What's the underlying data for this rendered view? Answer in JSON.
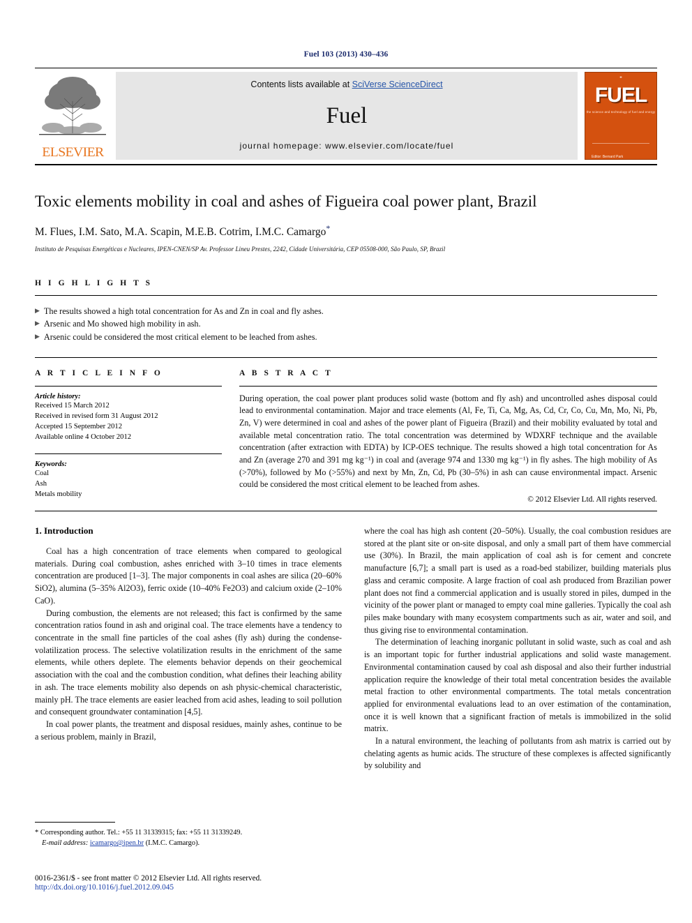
{
  "running_head": "Fuel 103 (2013) 430–436",
  "banner": {
    "publisher_name": "ELSEVIER",
    "contents_prefix": "Contents lists available at ",
    "contents_link": "SciVerse ScienceDirect",
    "journal_name": "Fuel",
    "homepage": "journal homepage: www.elsevier.com/locate/fuel",
    "cover_title": "FUEL",
    "cover_subtitle": "the science and technology of fuel and energy",
    "cover_footer": "Editor: Bernard Park",
    "cover_color": "#d4510f",
    "link_color": "#2554a8"
  },
  "article": {
    "title": "Toxic elements mobility in coal and ashes of Figueira coal power plant, Brazil",
    "authors": "M. Flues, I.M. Sato, M.A. Scapin, M.E.B. Cotrim, I.M.C. Camargo",
    "corresponding_marker": "*",
    "affiliation": "Instituto de Pesquisas Energéticas e Nucleares, IPEN-CNEN/SP Av. Professor Lineu Prestes, 2242, Cidade Universitária, CEP 05508-000, São Paulo, SP, Brazil"
  },
  "highlights": {
    "heading": "H I G H L I G H T S",
    "bullet_glyph": "▶",
    "items": [
      "The results showed a high total concentration for As and Zn in coal and fly ashes.",
      "Arsenic and Mo showed high mobility in ash.",
      "Arsenic could be considered the most critical element to be leached from ashes."
    ]
  },
  "article_info": {
    "heading": "A R T I C L E   I N F O",
    "history_heading": "Article history:",
    "history": [
      "Received 15 March 2012",
      "Received in revised form 31 August 2012",
      "Accepted 15 September 2012",
      "Available online 4 October 2012"
    ],
    "keywords_heading": "Keywords:",
    "keywords": [
      "Coal",
      "Ash",
      "Metals mobility"
    ]
  },
  "abstract": {
    "heading": "A B S T R A C T",
    "text": "During operation, the coal power plant produces solid waste (bottom and fly ash) and uncontrolled ashes disposal could lead to environmental contamination. Major and trace elements (Al, Fe, Ti, Ca, Mg, As, Cd, Cr, Co, Cu, Mn, Mo, Ni, Pb, Zn, V) were determined in coal and ashes of the power plant of Figueira (Brazil) and their mobility evaluated by total and available metal concentration ratio. The total concentration was determined by WDXRF technique and the available concentration (after extraction with EDTA) by ICP-OES technique. The results showed a high total concentration for As and Zn (average 270 and 391 mg kg⁻¹) in coal and (average 974 and 1330 mg kg⁻¹) in fly ashes. The high mobility of As (>70%), followed by Mo (>55%) and next by Mn, Zn, Cd, Pb (30–5%) in ash can cause environmental impact. Arsenic could be considered the most critical element to be leached from ashes.",
    "copyright": "© 2012 Elsevier Ltd. All rights reserved."
  },
  "introduction": {
    "heading": "1. Introduction",
    "left_paragraphs": [
      "Coal has a high concentration of trace elements when compared to geological materials. During coal combustion, ashes enriched with 3–10 times in trace elements concentration are produced [1–3]. The major components in coal ashes are silica (20–60% SiO2), alumina (5–35% Al2O3), ferric oxide (10–40% Fe2O3) and calcium oxide (2–10% CaO).",
      "During combustion, the elements are not released; this fact is confirmed by the same concentration ratios found in ash and original coal. The trace elements have a tendency to concentrate in the small fine particles of the coal ashes (fly ash) during the condense-volatilization process. The selective volatilization results in the enrichment of the same elements, while others deplete. The elements behavior depends on their geochemical association with the coal and the combustion condition, what defines their leaching ability in ash. The trace elements mobility also depends on ash physic-chemical characteristic, mainly pH. The trace elements are easier leached from acid ashes, leading to soil pollution and consequent groundwater contamination [4,5].",
      "In coal power plants, the treatment and disposal residues, mainly ashes, continue to be a serious problem, mainly in Brazil,"
    ],
    "right_paragraphs": [
      "where the coal has high ash content (20–50%). Usually, the coal combustion residues are stored at the plant site or on-site disposal, and only a small part of them have commercial use (30%). In Brazil, the main application of coal ash is for cement and concrete manufacture [6,7]; a small part is used as a road-bed stabilizer, building materials plus glass and ceramic composite. A large fraction of coal ash produced from Brazilian power plant does not find a commercial application and is usually stored in piles, dumped in the vicinity of the power plant or managed to empty coal mine galleries. Typically the coal ash piles make boundary with many ecosystem compartments such as air, water and soil, and thus giving rise to environmental contamination.",
      "The determination of leaching inorganic pollutant in solid waste, such as coal and ash is an important topic for further industrial applications and solid waste management. Environmental contamination caused by coal ash disposal and also their further industrial application require the knowledge of their total metal concentration besides the available metal fraction to other environmental compartments. The total metals concentration applied for environmental evaluations lead to an over estimation of the contamination, once it is well known that a significant fraction of metals is immobilized in the solid matrix.",
      "In a natural environment, the leaching of pollutants from ash matrix is carried out by chelating agents as humic acids. The structure of these complexes is affected significantly by solubility and"
    ]
  },
  "footnote": {
    "marker": "*",
    "corresponding": "Corresponding author. Tel.: +55 11 31339315; fax: +55 11 31339249.",
    "email_label": "E-mail address:",
    "email": "icamargo@ipen.br",
    "email_owner": "(I.M.C. Camargo)."
  },
  "footer": {
    "issn_line": "0016-2361/$ - see front matter © 2012 Elsevier Ltd. All rights reserved.",
    "doi": "http://dx.doi.org/10.1016/j.fuel.2012.09.045"
  }
}
